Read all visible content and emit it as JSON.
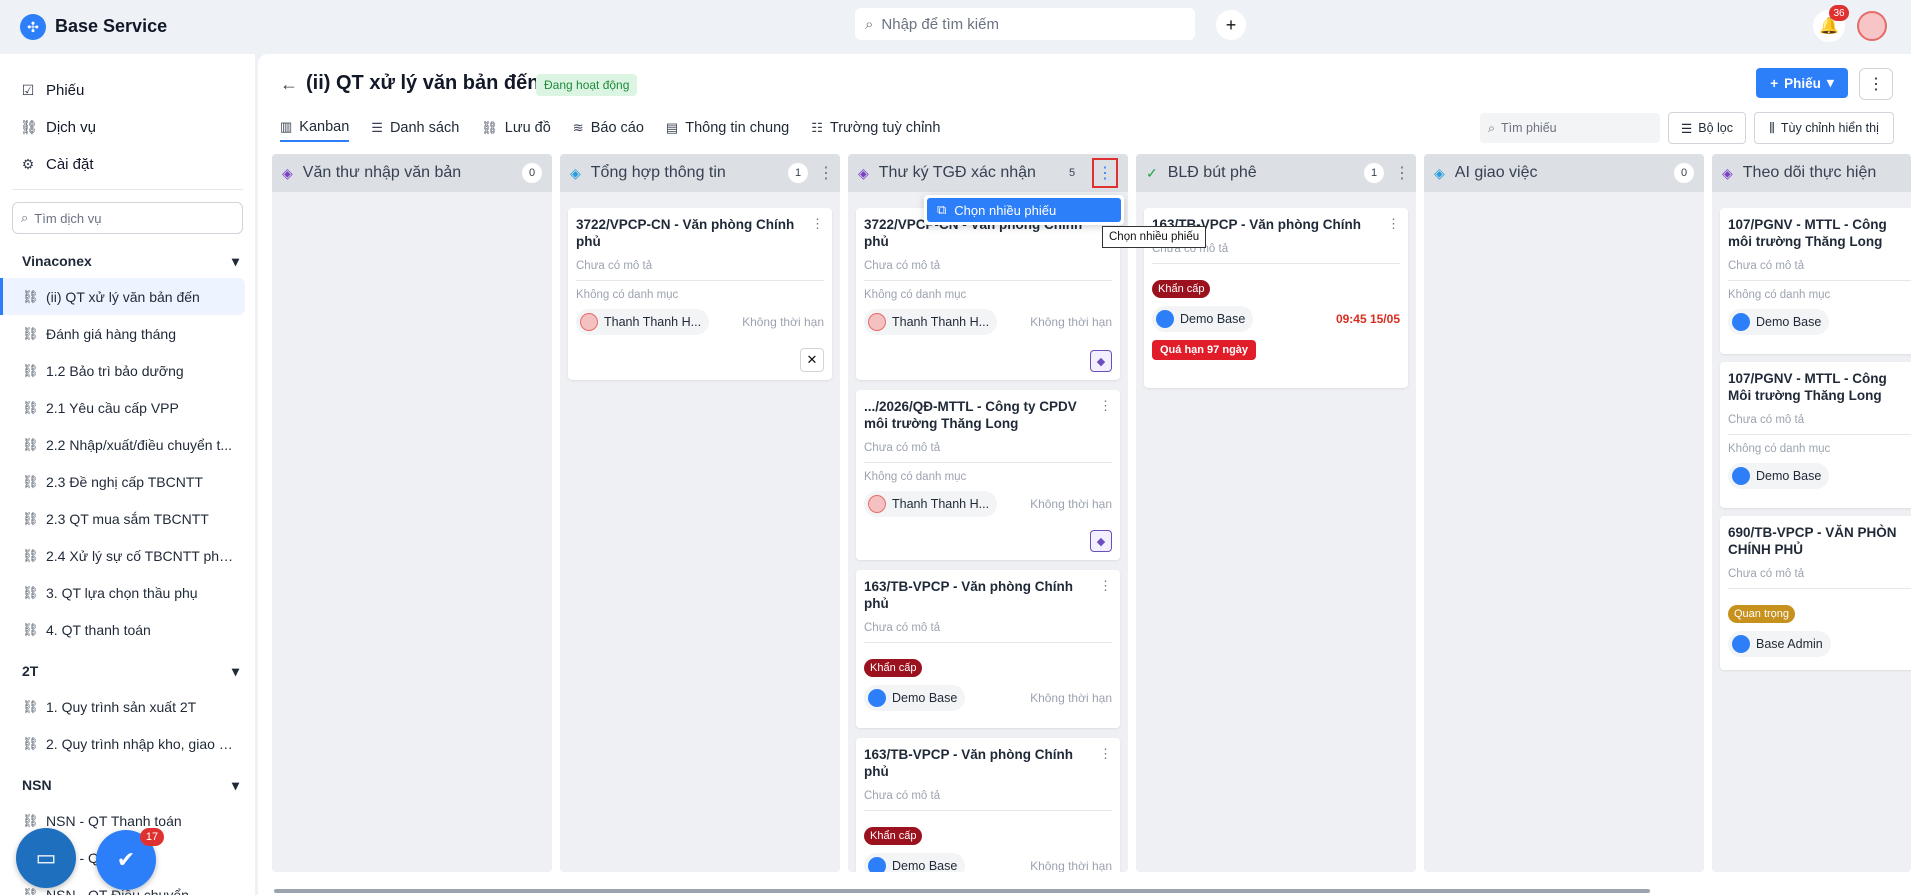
{
  "app": {
    "title": "Base Service"
  },
  "topbar": {
    "search_placeholder": "Nhập để tìm kiếm",
    "add_label": "+",
    "notif_count": "36"
  },
  "sidebar": {
    "nav": [
      {
        "label": "Phiếu",
        "icon": "check-square-icon"
      },
      {
        "label": "Dịch vụ",
        "icon": "flow-icon"
      },
      {
        "label": "Cài đặt",
        "icon": "gear-icon"
      }
    ],
    "search_placeholder": "Tìm dịch vụ",
    "groups": [
      {
        "name": "Vinaconex",
        "items": [
          "(ii) QT xử lý văn bản đến",
          "Đánh giá hàng tháng",
          "1.2 Bảo trì bảo dưỡng",
          "2.1 Yêu cầu cấp VPP",
          "2.2 Nhập/xuất/điều chuyển t...",
          "2.3 Đề nghị cấp TBCNTT",
          "2.3 QT mua sắm TBCNTT",
          "2.4 Xử lý sự cố TBCNTT phá...",
          "3. QT lựa chọn thầu phụ",
          "4. QT thanh toán"
        ]
      },
      {
        "name": "2T",
        "items": [
          "1. Quy trình sản xuất 2T",
          "2. Quy trình nhập kho, giao h..."
        ]
      },
      {
        "name": "NSN",
        "items": [
          "NSN - QT Thanh toán",
          "NSN - QT ...ng",
          "NSN - QT Điều chuyển"
        ]
      }
    ]
  },
  "fab": {
    "chat_icon": "chat-icon",
    "tasks_badge": "17"
  },
  "page": {
    "back_icon": "arrow-left-icon",
    "title": "(ii) QT xử lý văn bản đến",
    "status": "Đang hoạt động",
    "new_button": "Phiếu",
    "tabs": [
      "Kanban",
      "Danh sách",
      "Lưu đồ",
      "Báo cáo",
      "Thông tin chung",
      "Trường tuỳ chỉnh"
    ],
    "ticket_search_placeholder": "Tìm phiếu",
    "filter_label": "Bộ lọc",
    "display_label": "Tùy chỉnh hiển thị"
  },
  "columns": [
    {
      "title": "Văn thư nhập văn bản",
      "count": "0",
      "icon_color": "#7b3fc4",
      "cards": []
    },
    {
      "title": "Tổng hợp thông tin",
      "count": "1",
      "icon_color": "#2d9cdb",
      "cards": [
        {
          "title": "3722/VPCP-CN - Văn phòng Chính phủ",
          "desc": "Chưa có mô tả",
          "cat": "Không có danh mục",
          "assignee": "Thanh Thanh H...",
          "deadline": "Không thời hạn"
        }
      ]
    },
    {
      "title": "Thư ký TGĐ xác nhận",
      "count": "5",
      "icon_color": "#7b3fc4",
      "cards": [
        {
          "title": "3722/VPCP-CN - Văn phòng Chính phủ",
          "desc": "Chưa có mô tả",
          "cat": "Không có danh mục",
          "assignee": "Thanh Thanh H...",
          "deadline": "Không thời hạn"
        },
        {
          "title": ".../2026/QĐ-MTTL - Công ty CPDV môi trường Thăng Long",
          "desc": "Chưa có mô tả",
          "cat": "Không có danh mục",
          "assignee": "Thanh Thanh H...",
          "deadline": "Không thời hạn"
        },
        {
          "title": "163/TB-VPCP - Văn phòng Chính phủ",
          "desc": "Chưa có mô tả",
          "tag": "Khẩn cấp",
          "assignee": "Demo Base",
          "deadline": "Không thời hạn"
        },
        {
          "title": "163/TB-VPCP - Văn phòng Chính phủ",
          "desc": "Chưa có mô tả",
          "tag": "Khẩn cấp",
          "assignee": "Demo Base",
          "deadline": "Không thời hạn"
        }
      ]
    },
    {
      "title": "BLĐ bút phê",
      "count": "1",
      "icon_color": "#22a34a",
      "cards": [
        {
          "title": "163/TB-VPCP - Văn phòng Chính",
          "desc": "Chưa có mô tả",
          "tag": "Khẩn cấp",
          "assignee": "Demo Base",
          "deadline": "09:45 15/05",
          "overdue": "Quá hạn 97 ngày"
        }
      ]
    },
    {
      "title": "AI giao việc",
      "count": "0",
      "icon_color": "#2d9cdb",
      "cards": []
    },
    {
      "title": "Theo dõi thực hiện",
      "count": "",
      "icon_color": "#7b3fc4",
      "cards": [
        {
          "title": "107/PGNV - MTTL - Công môi trường Thăng Long",
          "desc": "Chưa có mô tả",
          "cat": "Không có danh mục",
          "assignee": "Demo Base"
        },
        {
          "title": "107/PGNV - MTTL - Công Môi trường Thăng Long",
          "desc": "Chưa có mô tả",
          "cat": "Không có danh mục",
          "assignee": "Demo Base"
        },
        {
          "title": "690/TB-VPCP - VĂN PHÒN CHÍNH PHỦ",
          "desc": "Chưa có mô tả",
          "tag_important": "Quan trọng",
          "assignee": "Base Admin"
        }
      ]
    }
  ],
  "popup": {
    "menu_item": "Chọn nhiều phiếu",
    "tooltip": "Chọn nhiều phiếu"
  }
}
